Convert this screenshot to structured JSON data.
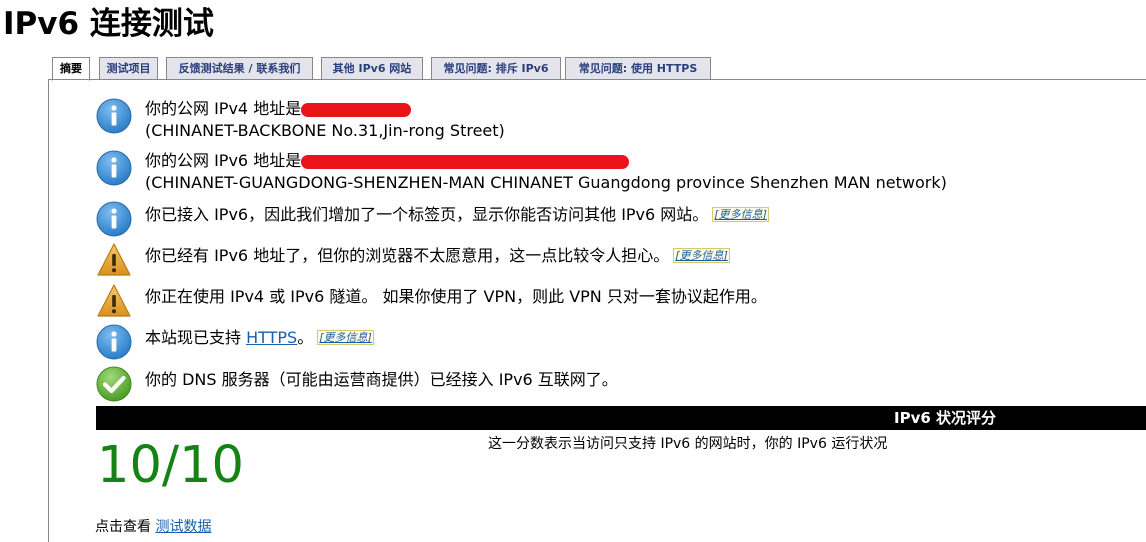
{
  "page": {
    "title": "IPv6 连接测试"
  },
  "tabs": [
    {
      "label": "摘要",
      "active": true
    },
    {
      "label": "测试项目",
      "active": false
    },
    {
      "label": "反馈测试结果 / 联系我们",
      "active": false
    },
    {
      "label": "其他 IPv6 网站",
      "active": false
    },
    {
      "label": "常见问题: 排斥 IPv6",
      "active": false
    },
    {
      "label": "常见问题: 使用 HTTPS",
      "active": false
    }
  ],
  "messages": [
    {
      "icon": "info-icon",
      "line1": "你的公网 IPv4 地址是",
      "line2": "(CHINANET-BACKBONE No.31,Jin-rong Street)"
    },
    {
      "icon": "info-icon",
      "line1": "你的公网 IPv6 地址是",
      "line2": "(CHINANET-GUANGDONG-SHENZHEN-MAN CHINANET Guangdong province Shenzhen MAN network)"
    },
    {
      "icon": "info-icon",
      "text": "你已接入 IPv6，因此我们增加了一个标签页，显示你能否访问其他 IPv6 网站。",
      "more": "[更多信息]"
    },
    {
      "icon": "warning-icon",
      "text": "你已经有 IPv6 地址了，但你的浏览器不太愿意用，这一点比较令人担心。",
      "more": "[更多信息]"
    },
    {
      "icon": "warning-icon",
      "text": "你正在使用 IPv4 或 IPv6 隧道。 如果你使用了 VPN，则此 VPN 只对一套协议起作用。"
    },
    {
      "icon": "info-icon",
      "text_before": "本站现已支持 ",
      "link": "HTTPS",
      "text_after": "。",
      "more": "[更多信息]"
    },
    {
      "icon": "check-icon",
      "text": "你的 DNS 服务器（可能由运营商提供）已经接入 IPv6 互联网了。"
    }
  ],
  "score": {
    "bar_label": "IPv6 状况评分",
    "value": "10/10",
    "description": "这一分数表示当访问只支持 IPv6 的网站时，你的 IPv6 运行状况"
  },
  "footer": {
    "prefix": "点击查看 ",
    "link": "测试数据"
  },
  "colors": {
    "info": "#3a8fd6",
    "warning": "#e8a735",
    "check": "#5cb030",
    "score": "#148314",
    "link": "#1a5fa8",
    "redaction": "#e8141a"
  }
}
